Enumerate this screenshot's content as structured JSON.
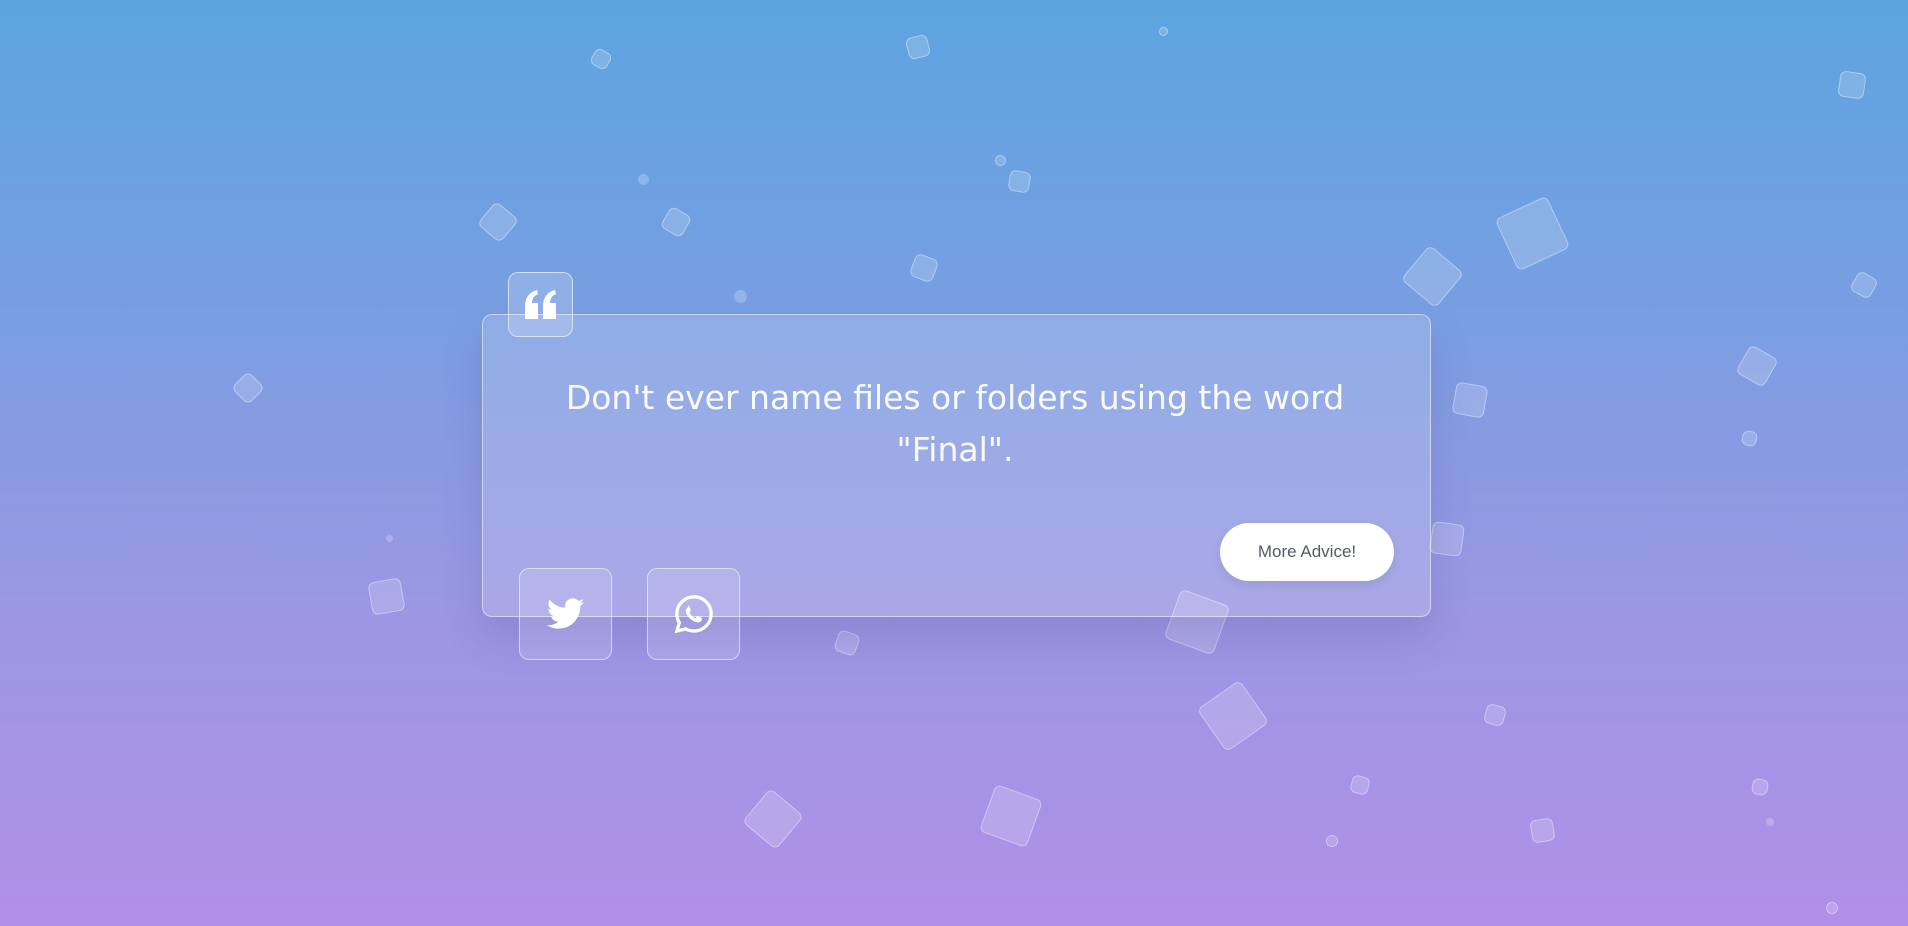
{
  "advice": {
    "text": "Don't ever name files or folders using the word \"Final\"."
  },
  "actions": {
    "more_label": "More Advice!"
  },
  "share": {
    "twitter_icon": "twitter-icon",
    "whatsapp_icon": "whatsapp-icon"
  },
  "decoration": {
    "quote_icon": "quote-icon"
  },
  "colors": {
    "gradient_top": "#5ca4df",
    "gradient_bottom": "#b190e8",
    "button_bg": "#ffffff",
    "button_text": "#555b66"
  }
}
